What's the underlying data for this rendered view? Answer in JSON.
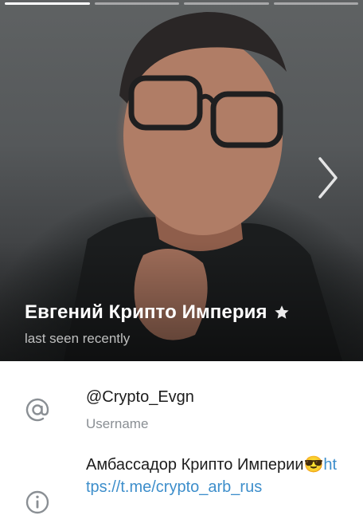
{
  "profile": {
    "name": "Евгений Крипто Империя",
    "status": "last seen recently",
    "username": "@Crypto_Evgn",
    "username_label": "Username",
    "bio_text": "Амбассадор Крипто Империи😎",
    "bio_link": "https://t.me/crypto_arb_rus"
  },
  "story_bars": [
    {
      "state": "active"
    },
    {
      "state": "inactive"
    },
    {
      "state": "inactive"
    },
    {
      "state": "inactive"
    }
  ],
  "icons": {
    "next": "chevron-right-icon",
    "verified": "star-icon",
    "username": "at-sign-icon",
    "bio": "info-icon"
  },
  "colors": {
    "link": "#3d8ecb",
    "secondary_text": "#8a8f94",
    "primary_text": "#1c1c1c"
  }
}
